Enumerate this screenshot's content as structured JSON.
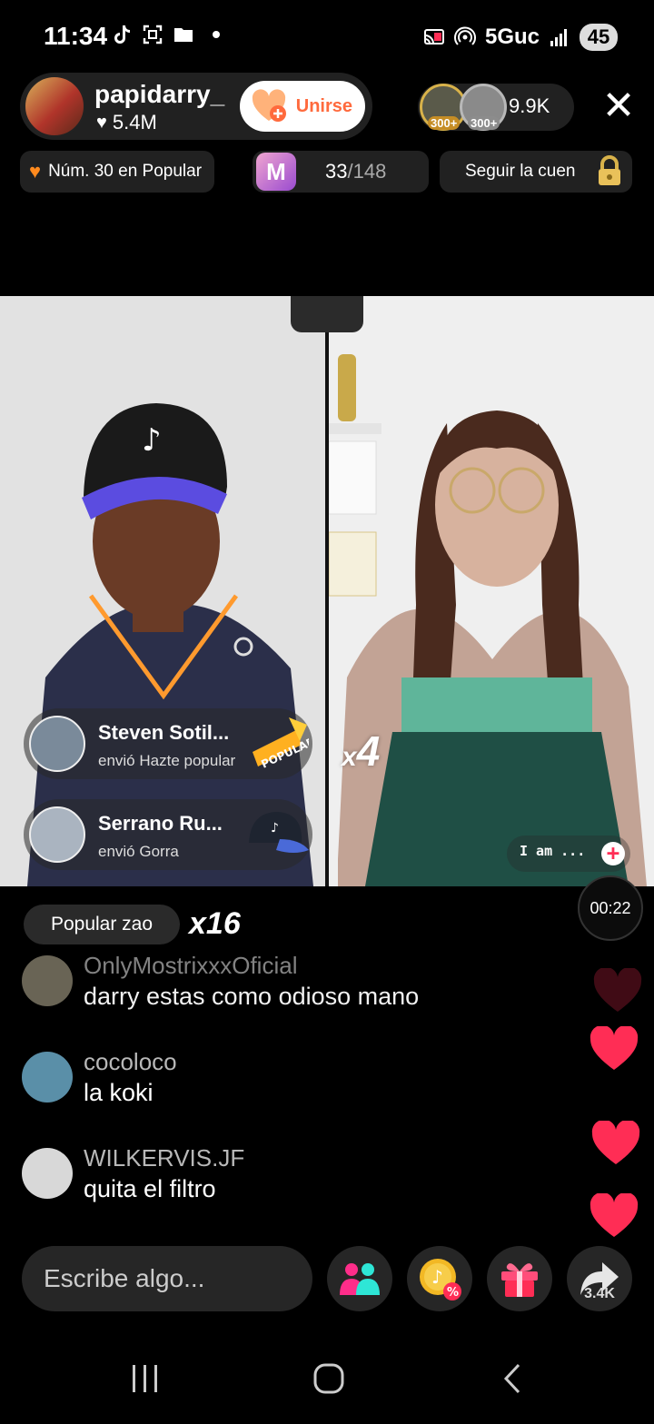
{
  "status_bar": {
    "time": "11:34",
    "network": "5Guc",
    "battery": "45",
    "left_icons": [
      "tiktok-icon",
      "screenshot-icon",
      "folder-icon",
      "dot"
    ],
    "right_icons": [
      "cast-icon",
      "hotspot-icon",
      "signal-icon"
    ]
  },
  "host": {
    "name": "papidarry_",
    "likes": "5.4M",
    "join_label": "Unirse"
  },
  "viewers": {
    "badge1": "300+",
    "badge2": "300+",
    "count": "9.9K"
  },
  "ranking": {
    "label": "Núm. 30 en Popular"
  },
  "score": {
    "icon_letter": "M",
    "current": "33",
    "total": "/148"
  },
  "follow": {
    "label": "Seguir la cuen"
  },
  "battle": {
    "multiplier_right": "4",
    "multiplier_prefix": "x"
  },
  "gift_feed": [
    {
      "name": "Steven Sotil...",
      "action": "envió Hazte popular",
      "gift": "POPULAR"
    },
    {
      "name": "Serrano Ru...",
      "action": "envió Gorra",
      "gift": "cap"
    }
  ],
  "iam_tag": {
    "text": "I am ...",
    "plus": "+"
  },
  "popular_chip": {
    "label": "Popular zao",
    "count": "x16"
  },
  "timer": "00:22",
  "comments": [
    {
      "user": "OnlyMostrixxxOficial",
      "text": "darry estas como odioso mano"
    },
    {
      "user": "cocoloco",
      "text": "la koki"
    },
    {
      "user": "WILKERVIS.JF",
      "text": "quita el filtro"
    }
  ],
  "input": {
    "placeholder": "Escribe algo..."
  },
  "share_count": "3.4K",
  "colors": {
    "accent": "#ff2d55",
    "orange": "#ff8a1e",
    "pill_bg": "#262626"
  }
}
